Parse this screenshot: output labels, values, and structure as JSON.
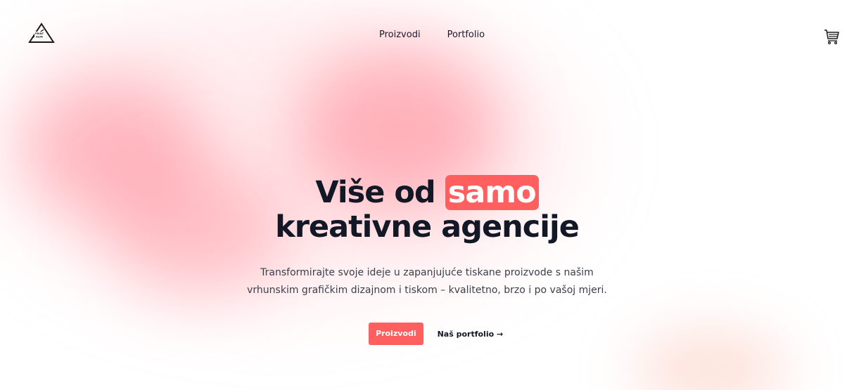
{
  "brand": {
    "logo_text_top": "PRINT",
    "logo_text_bottom": "ALFA"
  },
  "nav": {
    "links": [
      {
        "label": "Proizvodi"
      },
      {
        "label": "Portfolio"
      }
    ],
    "cart_icon": "cart-icon"
  },
  "hero": {
    "headline_part1": "Više od ",
    "headline_highlight": "samo",
    "headline_line2": "kreativne agencije",
    "subtitle_line1": "Transformirajte svoje ideje u zapanjujuće tiskane proizvode s našim",
    "subtitle_line2": "vrhunskim grafičkim dizajnom i tiskom – kvalitetno, brzo i po vašoj mjeri.",
    "primary_button": "Proizvodi",
    "secondary_link": "Naš portfolio →"
  },
  "colors": {
    "accent": "#ff5f5f",
    "text": "#121826"
  }
}
